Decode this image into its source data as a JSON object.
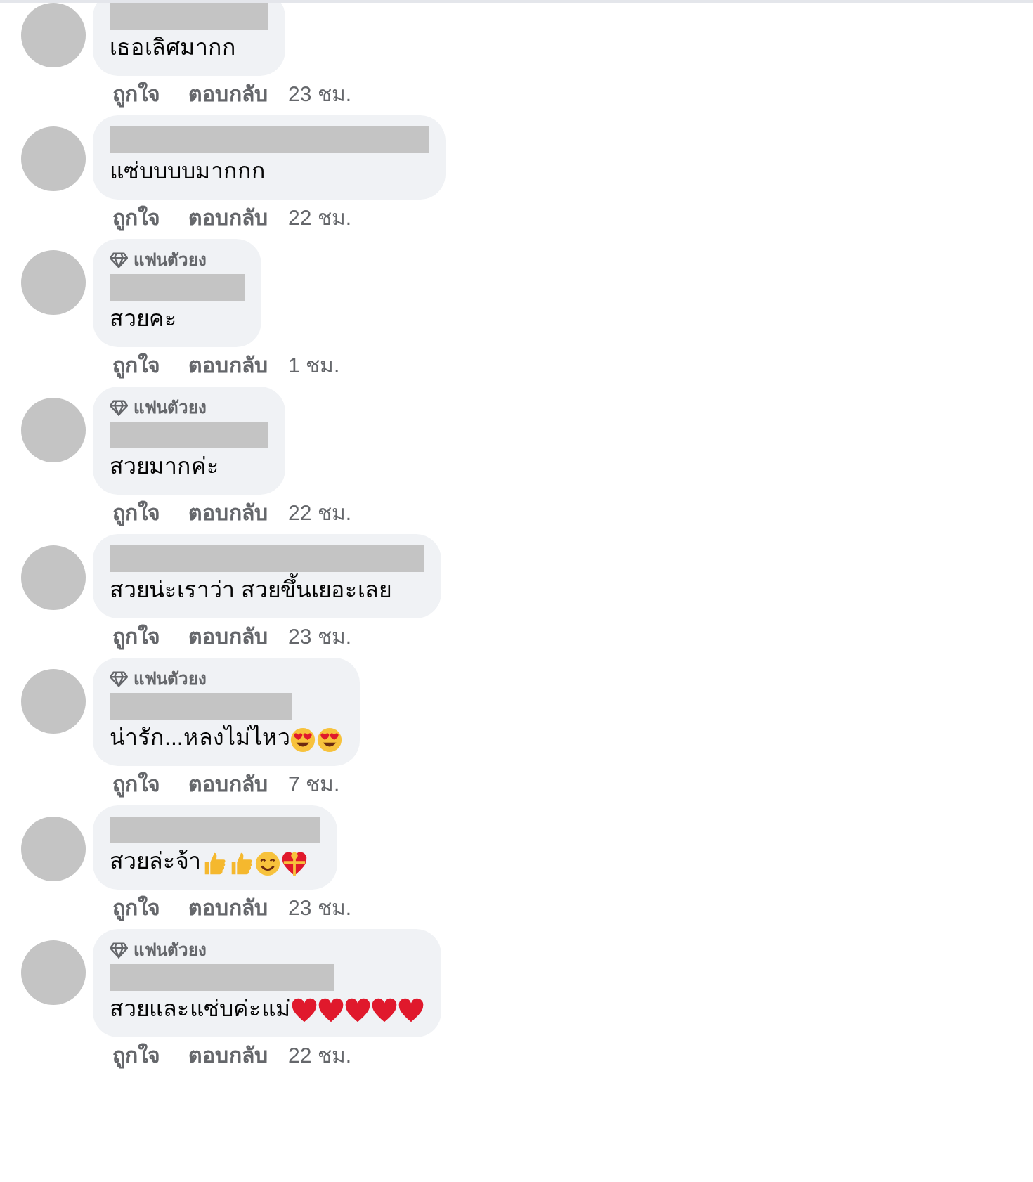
{
  "comments": [
    {
      "text": "เธอเลิศมากก",
      "actions": [
        "ถูกใจ",
        "ตอบกลับ"
      ],
      "time": "23 ชม."
    },
    {
      "text": "แซ่บบบบมากกก",
      "actions": [
        "ถูกใจ",
        "ตอบกลับ"
      ],
      "time": "22 ชม."
    },
    {
      "badge": "แฟนตัวยง",
      "text": "สวยคะ",
      "actions": [
        "ถูกใจ",
        "ตอบกลับ"
      ],
      "time": "1 ชม."
    },
    {
      "badge": "แฟนตัวยง",
      "text": "สวยมากค่ะ",
      "actions": [
        "ถูกใจ",
        "ตอบกลับ"
      ],
      "time": "22 ชม."
    },
    {
      "text": "สวยน่ะเราว่า สวยขึ้นเยอะเลย",
      "actions": [
        "ถูกใจ",
        "ตอบกลับ"
      ],
      "time": "23 ชม."
    },
    {
      "badge": "แฟนตัวยง",
      "text": "น่ารัก...หลงไม่ไหว",
      "icons": [
        {
          "kind": "heart-eyes"
        },
        {
          "kind": "heart-eyes"
        }
      ],
      "actions": [
        "ถูกใจ",
        "ตอบกลับ"
      ],
      "time": "7 ชม."
    },
    {
      "text": "สวยล่ะจ้า",
      "icons": [
        {
          "kind": "thumbs-up"
        },
        {
          "kind": "thumbs-up"
        },
        {
          "kind": "smile"
        },
        {
          "kind": "gift-heart"
        }
      ],
      "actions": [
        "ถูกใจ",
        "ตอบกลับ"
      ],
      "time": "23 ชม."
    },
    {
      "badge": "แฟนตัวยง",
      "text": "สวยและแซ่บค่ะแม่",
      "icons": [
        {
          "kind": "heart"
        },
        {
          "kind": "heart"
        },
        {
          "kind": "heart"
        },
        {
          "kind": "heart"
        },
        {
          "kind": "heart"
        }
      ],
      "actions": [
        "ถูกใจ",
        "ตอบกลับ"
      ],
      "time": "22 ชม."
    }
  ]
}
